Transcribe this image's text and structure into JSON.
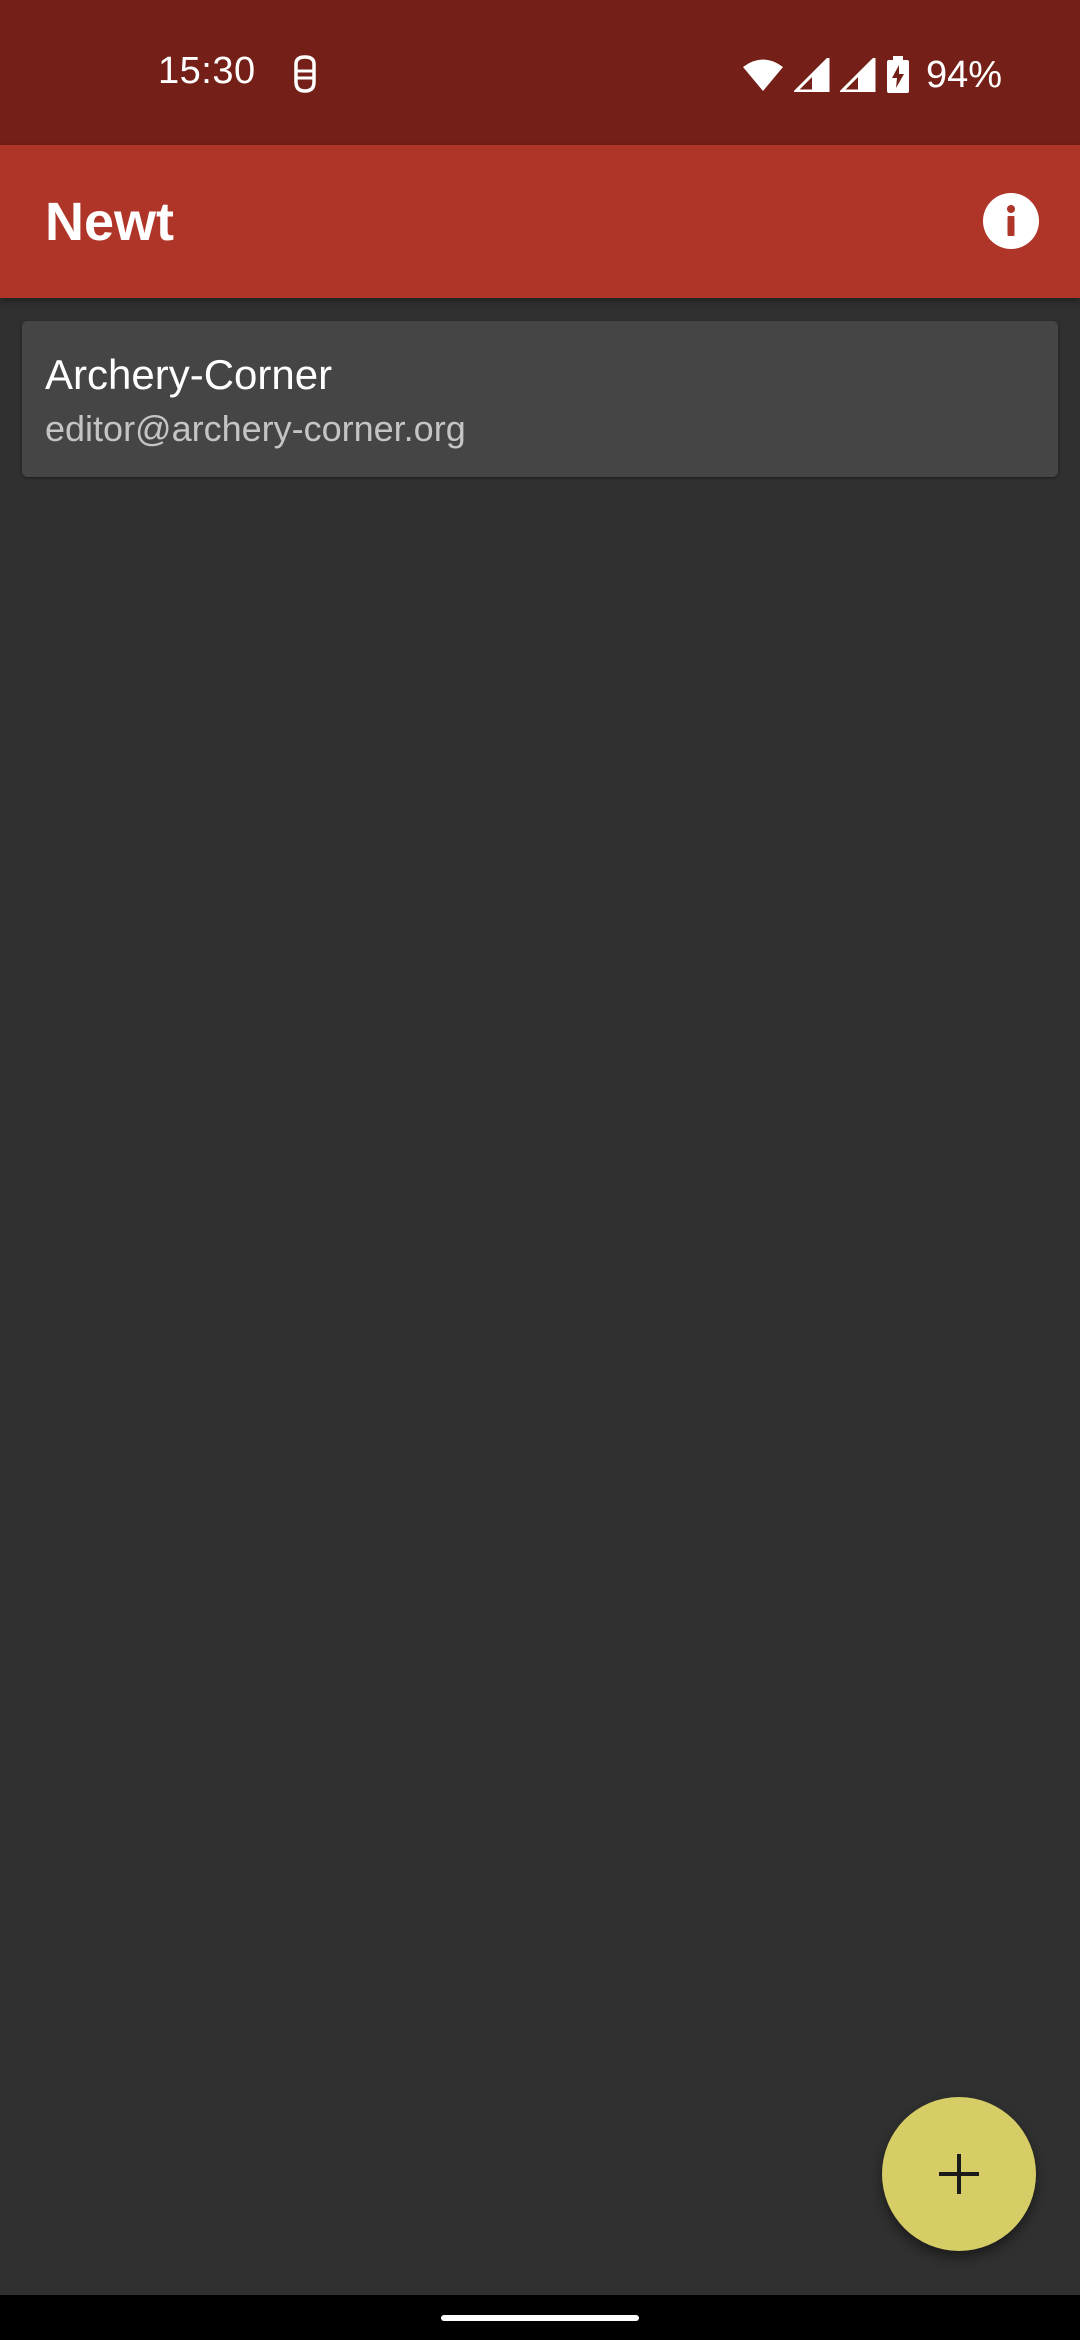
{
  "status_bar": {
    "time": "15:30",
    "battery_percent": "94%",
    "icons": [
      "notification-app-icon",
      "wifi-icon",
      "cell-signal-icon",
      "cell-signal-icon",
      "battery-charging-icon"
    ]
  },
  "app_bar": {
    "title": "Newt",
    "info_icon": "info-icon"
  },
  "accounts": [
    {
      "name": "Archery-Corner",
      "email": "editor@archery-corner.org"
    }
  ],
  "fab": {
    "icon": "plus-icon"
  },
  "colors": {
    "status_bar": "#741f17",
    "app_bar": "#b03529",
    "background": "#303030",
    "card": "#454545",
    "fab": "#d6cd66"
  }
}
